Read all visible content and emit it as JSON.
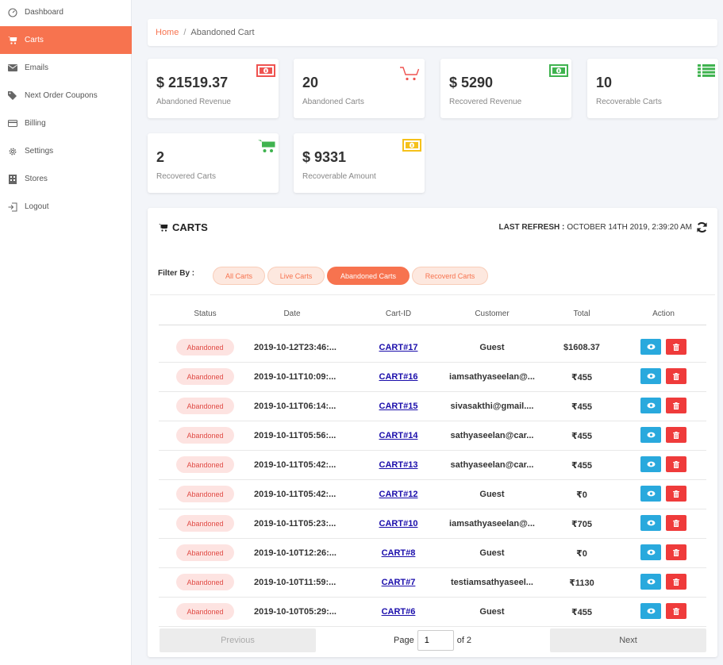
{
  "sidebar": {
    "items": [
      {
        "label": "Dashboard",
        "icon": "dashboard-icon"
      },
      {
        "label": "Carts",
        "icon": "cart-icon",
        "active": true
      },
      {
        "label": "Emails",
        "icon": "envelope-icon"
      },
      {
        "label": "Next Order Coupons",
        "icon": "tags-icon"
      },
      {
        "label": "Billing",
        "icon": "credit-card-icon"
      },
      {
        "label": "Settings",
        "icon": "gear-icon"
      },
      {
        "label": "Stores",
        "icon": "building-icon"
      },
      {
        "label": "Logout",
        "icon": "logout-icon"
      }
    ]
  },
  "breadcrumb": {
    "home": "Home",
    "separator": "/",
    "current": "Abandoned Cart"
  },
  "stats": [
    {
      "value": "$ 21519.37",
      "label": "Abandoned Revenue",
      "icon": "money-icon",
      "color": "#ef5350"
    },
    {
      "value": "20",
      "label": "Abandoned Carts",
      "icon": "cart-icon",
      "color": "#ef5350"
    },
    {
      "value": "$ 5290",
      "label": "Recovered Revenue",
      "icon": "money-icon",
      "color": "#3fb34f"
    },
    {
      "value": "10",
      "label": "Recoverable Carts",
      "icon": "list-icon",
      "color": "#3fb34f"
    },
    {
      "value": "2",
      "label": "Recovered Carts",
      "icon": "cart-icon",
      "color": "#3fb34f"
    },
    {
      "value": "$ 9331",
      "label": "Recoverable Amount",
      "icon": "money-icon",
      "color": "#f5c11b"
    }
  ],
  "carts": {
    "title": "CARTS",
    "last_refresh_label": "LAST REFRESH :",
    "last_refresh_value": "OCTOBER 14TH 2019, 2:39:20 AM",
    "filter_label": "Filter By :",
    "filters": [
      {
        "label": "All Carts",
        "selected": false
      },
      {
        "label": "Live Carts",
        "selected": false
      },
      {
        "label": "Abandoned Carts",
        "selected": true
      },
      {
        "label": "Recoverd Carts",
        "selected": false
      }
    ],
    "columns": [
      "Status",
      "Date",
      "Cart-ID",
      "Customer",
      "Total",
      "Action"
    ],
    "rows": [
      {
        "status": "Abandoned",
        "date": "2019-10-12T23:46:...",
        "cart_id": "CART#17",
        "customer": "Guest",
        "total": "$1608.37"
      },
      {
        "status": "Abandoned",
        "date": "2019-10-11T10:09:...",
        "cart_id": "CART#16",
        "customer": "iamsathyaseelan@...",
        "total": "₹455"
      },
      {
        "status": "Abandoned",
        "date": "2019-10-11T06:14:...",
        "cart_id": "CART#15",
        "customer": "sivasakthi@gmail....",
        "total": "₹455"
      },
      {
        "status": "Abandoned",
        "date": "2019-10-11T05:56:...",
        "cart_id": "CART#14",
        "customer": "sathyaseelan@car...",
        "total": "₹455"
      },
      {
        "status": "Abandoned",
        "date": "2019-10-11T05:42:...",
        "cart_id": "CART#13",
        "customer": "sathyaseelan@car...",
        "total": "₹455"
      },
      {
        "status": "Abandoned",
        "date": "2019-10-11T05:42:...",
        "cart_id": "CART#12",
        "customer": "Guest",
        "total": "₹0"
      },
      {
        "status": "Abandoned",
        "date": "2019-10-11T05:23:...",
        "cart_id": "CART#10",
        "customer": "iamsathyaseelan@...",
        "total": "₹705"
      },
      {
        "status": "Abandoned",
        "date": "2019-10-10T12:26:...",
        "cart_id": "CART#8",
        "customer": "Guest",
        "total": "₹0"
      },
      {
        "status": "Abandoned",
        "date": "2019-10-10T11:59:...",
        "cart_id": "CART#7",
        "customer": "testiamsathyaseel...",
        "total": "₹1130"
      },
      {
        "status": "Abandoned",
        "date": "2019-10-10T05:29:...",
        "cart_id": "CART#6",
        "customer": "Guest",
        "total": "₹455"
      }
    ],
    "pagination": {
      "prev": "Previous",
      "next": "Next",
      "page_label": "Page",
      "page": "1",
      "of_label": "of 2"
    }
  },
  "colors": {
    "accent": "#f7734f",
    "view": "#29a9dd",
    "delete": "#ef3b3b"
  }
}
